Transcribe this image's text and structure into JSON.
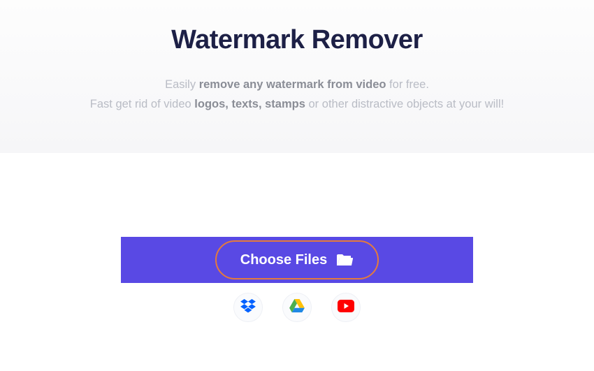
{
  "title": "Watermark Remover",
  "subtitle": {
    "line1_pre": "Easily ",
    "line1_em": "remove any watermark from video",
    "line1_post": " for free.",
    "line2_pre": "Fast get rid of video ",
    "line2_em": "logos, texts, stamps",
    "line2_post": " or other distractive objects at your will!"
  },
  "choose_label": "Choose Files",
  "sources": {
    "dropbox": "Dropbox",
    "gdrive": "Google Drive",
    "youtube": "YouTube"
  },
  "colors": {
    "upload_bar": "#5949e4",
    "choose_outline": "#e47a3d",
    "title": "#1d2046"
  }
}
